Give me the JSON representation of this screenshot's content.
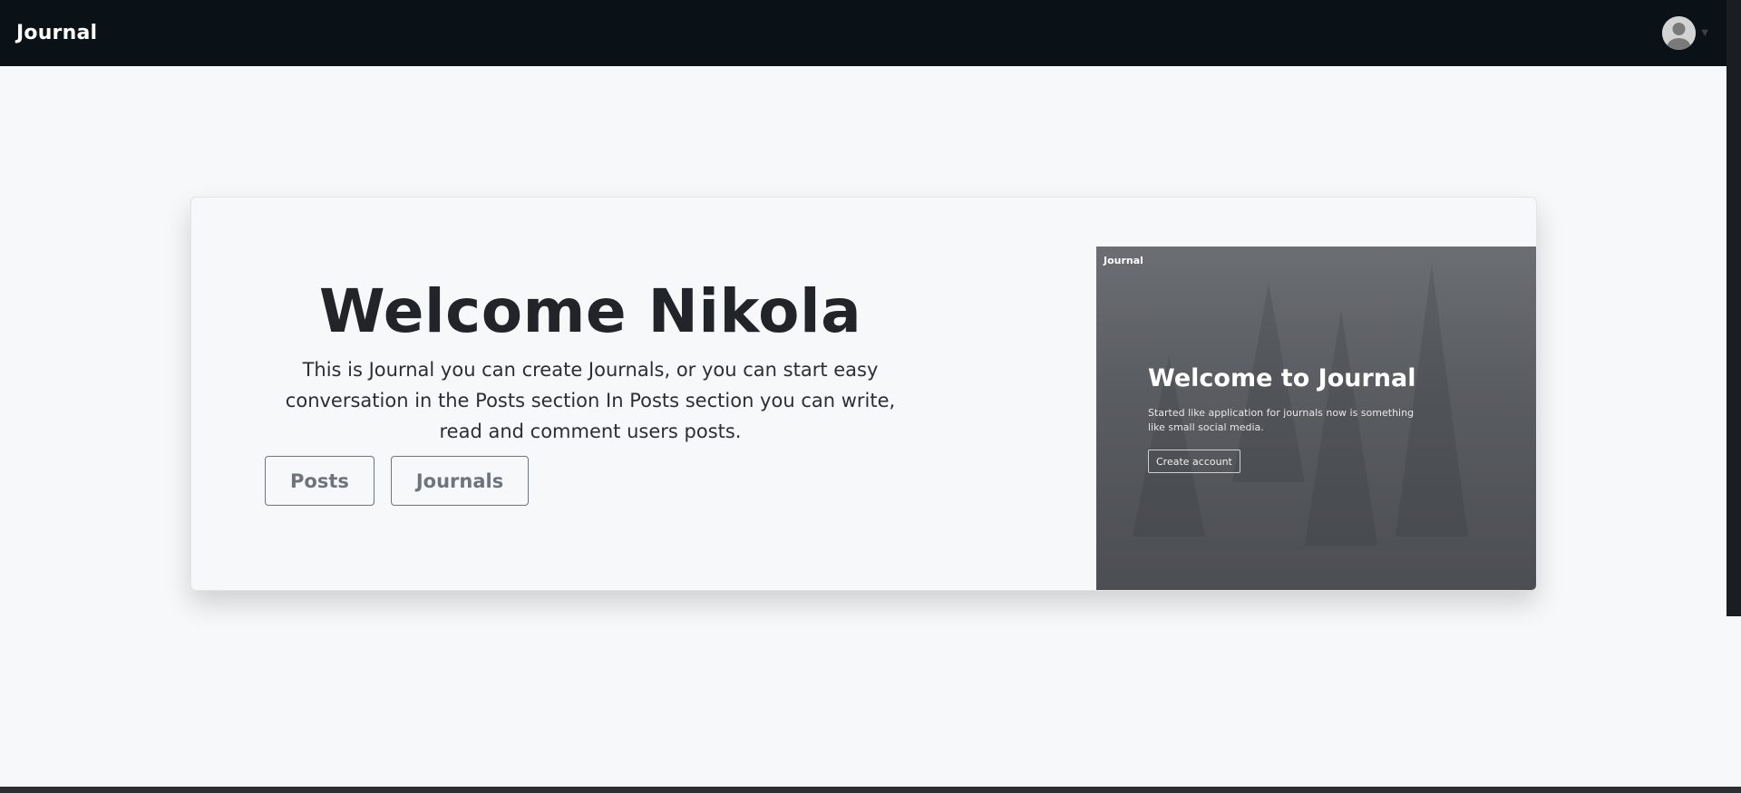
{
  "navbar": {
    "brand": "Journal"
  },
  "hero": {
    "title": "Welcome Nikola",
    "description": "This is Journal you can create Journals, or you can start easy conversation in the Posts section In Posts section you can write, read and comment users posts.",
    "buttons": {
      "posts": "Posts",
      "journals": "Journals"
    }
  },
  "preview": {
    "brand": "Journal",
    "title": "Welcome to Journal",
    "description": "Started like application for journals now is something like small social media.",
    "button": "Create account"
  },
  "icons": {
    "avatar": "user-avatar-icon",
    "caret": "chevron-down-icon"
  },
  "colors": {
    "navbar": "#0a1117",
    "background": "#f7f8fa",
    "button_outline": "#6c757d"
  }
}
